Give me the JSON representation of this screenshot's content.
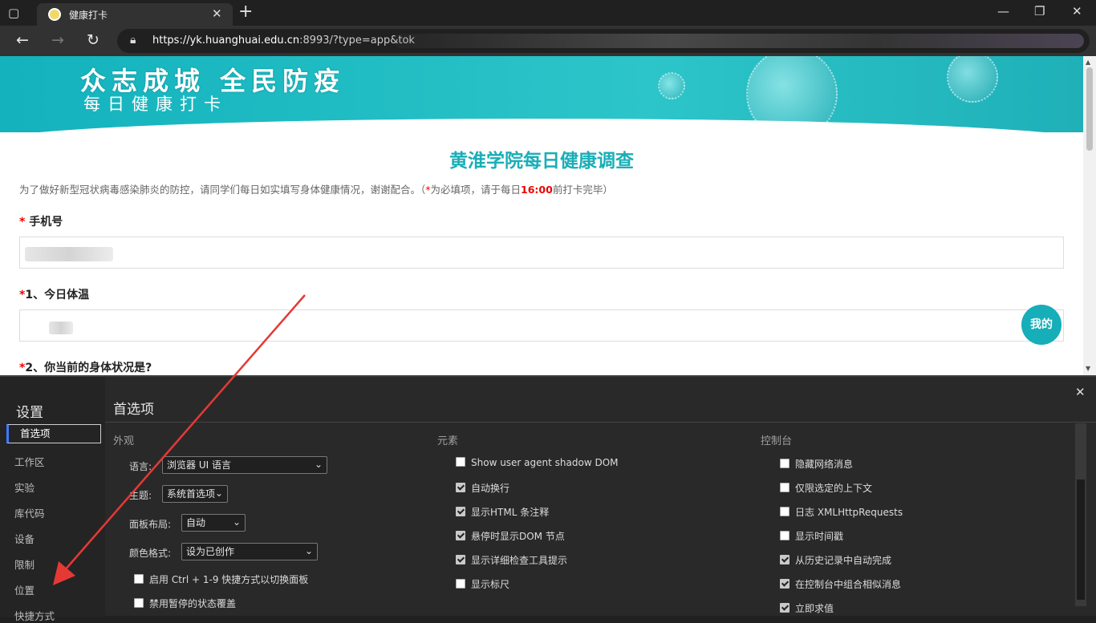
{
  "browser": {
    "tab_title": "健康打卡",
    "url_host": "https://yk.huanghuai.edu.cn",
    "url_rest": ":8993/?type=app&tok",
    "tab_close": "✕",
    "new_tab": "+",
    "win_minimize": "—",
    "win_restore": "❐",
    "win_close": "✕",
    "back": "←",
    "forward": "→",
    "reload": "↻"
  },
  "page": {
    "banner_title": "众志成城 全民防疫",
    "banner_sub": "每日健康打卡",
    "form_title": "黄淮学院每日健康调查",
    "intro_main": "为了做好新型冠状病毒感染肺炎的防控，请同学们每日如实填写身体健康情况，谢谢配合。（",
    "intro_star": "*",
    "intro_mid": "为必填项，请于每日",
    "intro_time": "16:00",
    "intro_end": "前打卡完毕）",
    "q_phone": "手机号",
    "q1": "1、今日体温",
    "q2": "2、你当前的身体状况是?",
    "star": "*",
    "mine_button": "我的"
  },
  "devtools": {
    "title": "设置",
    "close": "✕",
    "header": "首选项",
    "nav": [
      "首选项",
      "工作区",
      "实验",
      "库代码",
      "设备",
      "限制",
      "位置",
      "快捷方式"
    ],
    "appearance": {
      "title": "外观",
      "language_label": "语言:",
      "language_value": "浏览器 UI 语言",
      "theme_label": "主题:",
      "theme_value": "系统首选项",
      "layout_label": "面板布局:",
      "layout_value": "自动",
      "color_label": "颜色格式:",
      "color_value": "设为已创作",
      "checkboxes": [
        {
          "label": "启用 Ctrl + 1-9 快捷方式以切换面板",
          "checked": false
        },
        {
          "label": "禁用暂停的状态覆盖",
          "checked": false
        }
      ]
    },
    "elements": {
      "title": "元素",
      "checkboxes": [
        {
          "label": "Show user agent shadow DOM",
          "checked": false
        },
        {
          "label": "自动换行",
          "checked": true
        },
        {
          "label": "显示HTML 条注释",
          "checked": true
        },
        {
          "label": "悬停时显示DOM 节点",
          "checked": true
        },
        {
          "label": "显示详细检查工具提示",
          "checked": true
        },
        {
          "label": "显示标尺",
          "checked": false
        }
      ]
    },
    "console": {
      "title": "控制台",
      "checkboxes": [
        {
          "label": "隐藏网络消息",
          "checked": false
        },
        {
          "label": "仅限选定的上下文",
          "checked": false
        },
        {
          "label": "日志 XMLHttpRequests",
          "checked": false
        },
        {
          "label": "显示时间戳",
          "checked": false
        },
        {
          "label": "从历史记录中自动完成",
          "checked": true
        },
        {
          "label": "在控制台中组合相似消息",
          "checked": true
        },
        {
          "label": "立即求值",
          "checked": true
        }
      ]
    }
  },
  "colors": {
    "accent": "#1aaeb7",
    "required": "#ee0000",
    "annotation_arrow": "#e53935"
  }
}
